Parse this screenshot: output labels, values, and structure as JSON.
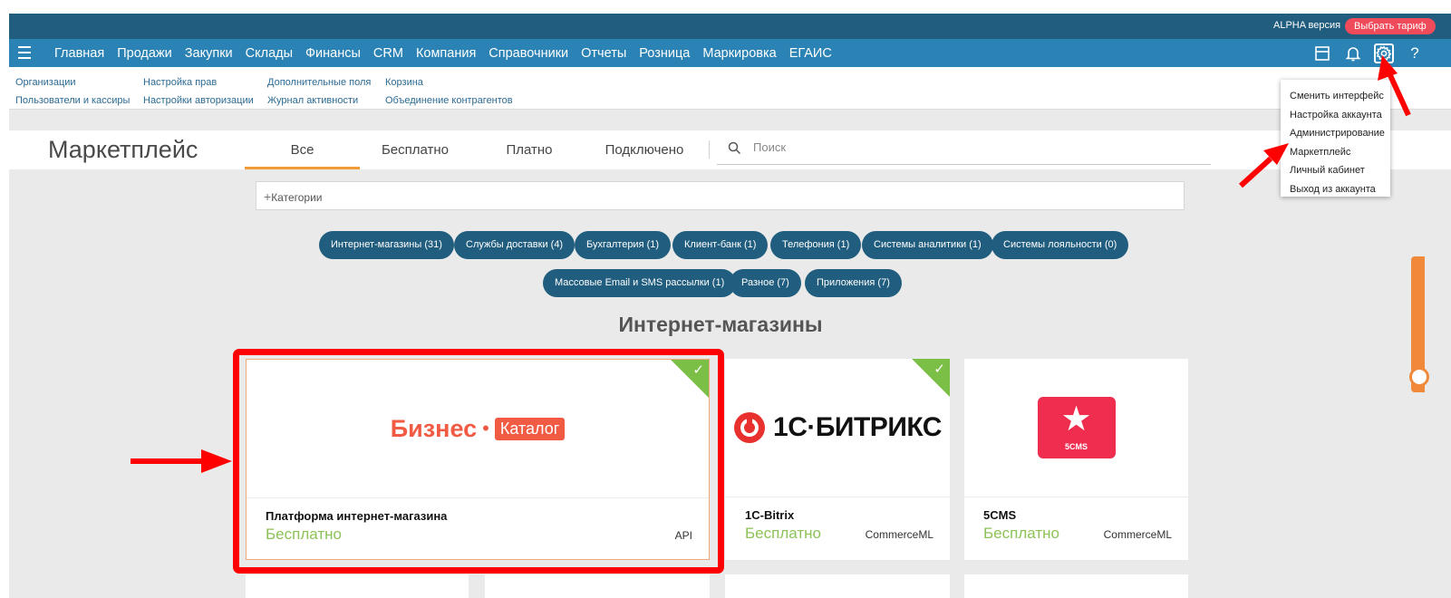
{
  "topbar": {
    "version_label": "ALPHA версия",
    "tariff_button": "Выбрать тариф"
  },
  "nav": {
    "items": [
      "Главная",
      "Продажи",
      "Закупки",
      "Склады",
      "Финансы",
      "CRM",
      "Компания",
      "Справочники",
      "Отчеты",
      "Розница",
      "Маркировка",
      "ЕГАИС"
    ],
    "icons": [
      "window-icon",
      "bell-icon",
      "gear-icon",
      "help-icon"
    ]
  },
  "subnav": {
    "col1": [
      "Организации",
      "Пользователи и кассиры"
    ],
    "col2": [
      "Настройка прав",
      "Настройки авторизации"
    ],
    "col3": [
      "Дополнительные поля",
      "Журнал активности"
    ],
    "col4": [
      "Корзина",
      "Объединение контрагентов"
    ]
  },
  "marketplace": {
    "title": "Маркетплейс",
    "tabs": [
      "Все",
      "Бесплатно",
      "Платно",
      "Подключено"
    ],
    "active_tab": "Все",
    "search_placeholder": "Поиск",
    "categories_label": "Категории"
  },
  "category_pills": [
    "Интернет-магазины (31)",
    "Службы доставки (4)",
    "Бухгалтерия (1)",
    "Клиент-банк (1)",
    "Телефония (1)",
    "Системы аналитики (1)",
    "Системы лояльности (0)",
    "Массовые Email и SMS рассылки (1)",
    "Разное (7)",
    "Приложения (7)"
  ],
  "section_title": "Интернет-магазины",
  "cards": [
    {
      "logo_word": "Бизнес",
      "logo_badge": "Каталог",
      "name": "Платформа интернет-магазина",
      "price": "Бесплатно",
      "tag": "API",
      "connected": true
    },
    {
      "logo_text": "1С·БИТРИКС",
      "name": "1C-Bitrix",
      "price": "Бесплатно",
      "tag": "CommerceML",
      "connected": true
    },
    {
      "logo_text": "5CMS",
      "name": "5CMS",
      "price": "Бесплатно",
      "tag": "CommerceML",
      "connected": false
    }
  ],
  "dropdown": [
    "Сменить интерфейс",
    "Настройка аккаунта",
    "Администрирование",
    "Маркетплейс",
    "Личный кабинет",
    "Выход из аккаунта"
  ],
  "colors": {
    "topbar": "#205d7e",
    "nav": "#2b82b4",
    "accent_orange": "#f39c37",
    "price_green": "#8cc257",
    "annotation_red": "#ff0000"
  }
}
